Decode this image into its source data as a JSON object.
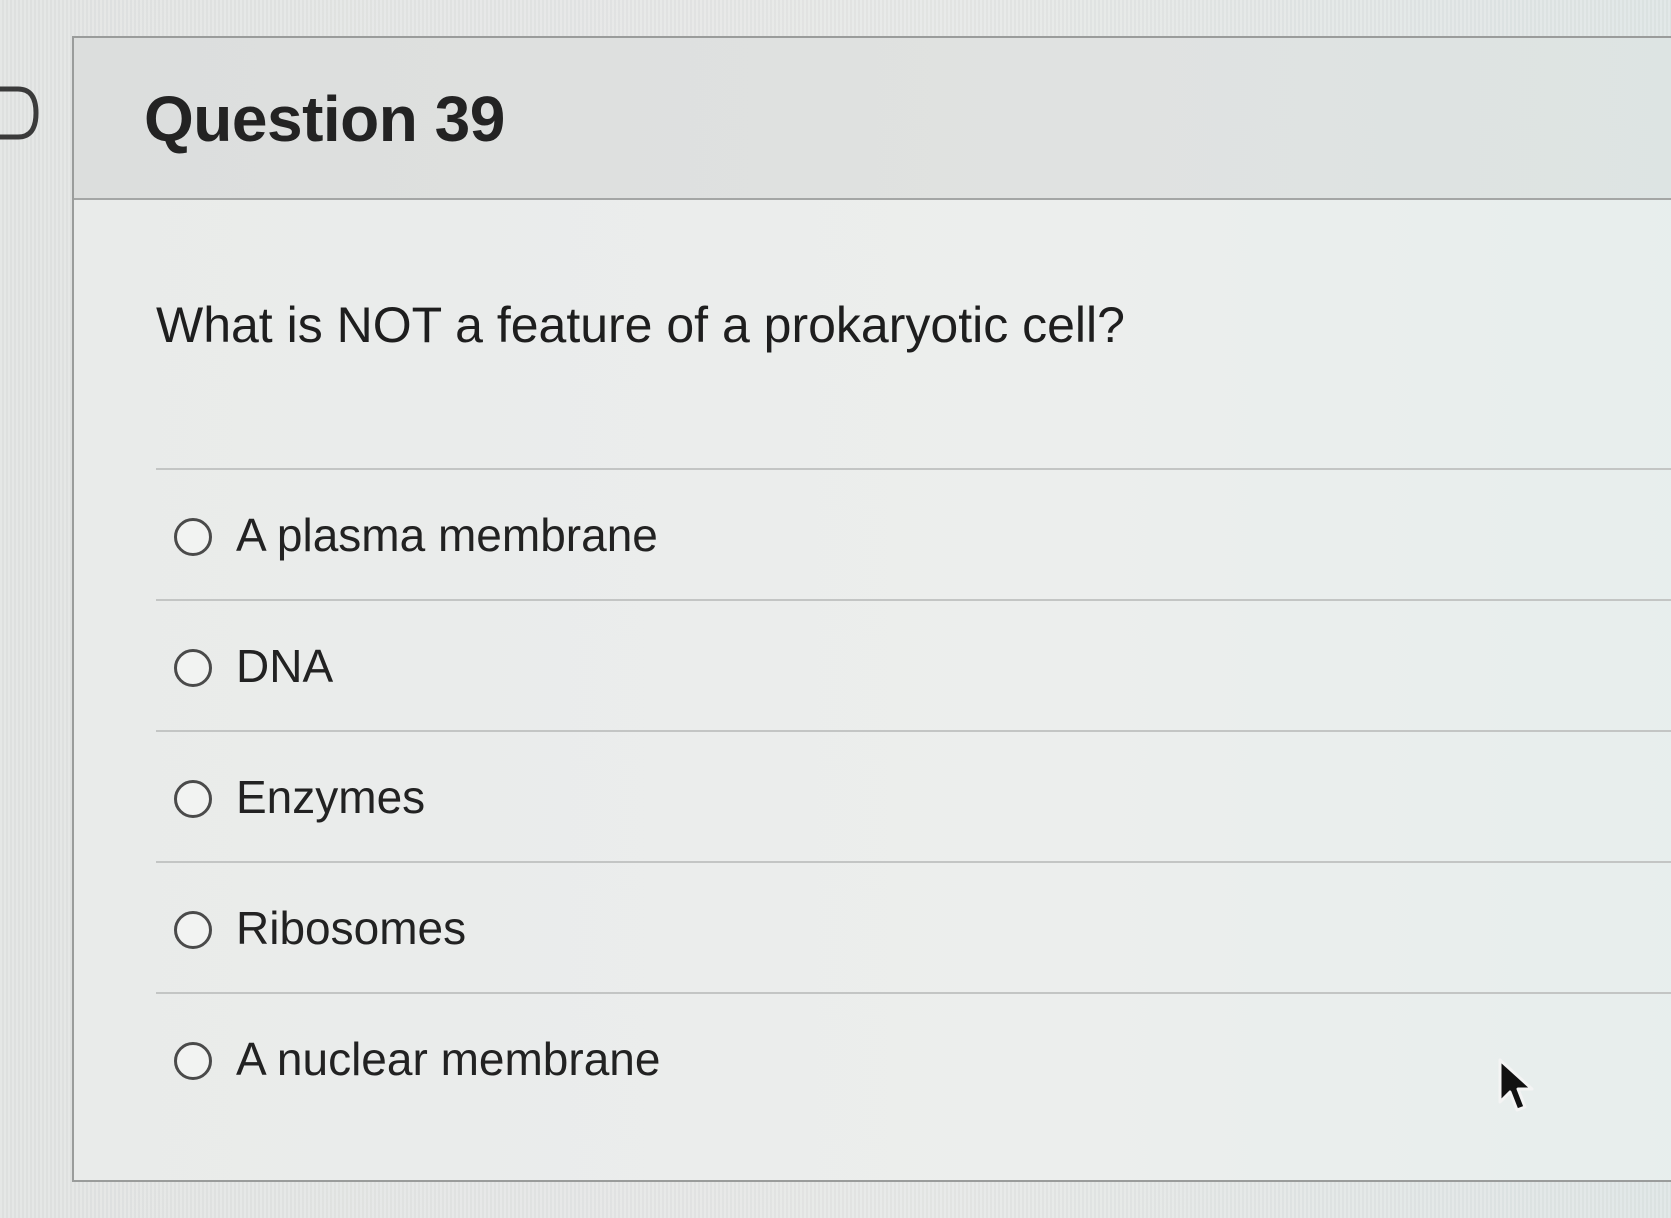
{
  "question": {
    "title": "Question 39",
    "text": "What is NOT a feature of a prokaryotic cell?",
    "answers": [
      {
        "label": "A plasma membrane",
        "selected": false
      },
      {
        "label": "DNA",
        "selected": false
      },
      {
        "label": "Enzymes",
        "selected": false
      },
      {
        "label": "Ribosomes",
        "selected": false
      },
      {
        "label": "A nuclear membrane",
        "selected": false
      }
    ]
  },
  "icons": {
    "flag": "flag-marker-icon",
    "radio": "radio-button-icon",
    "cursor": "mouse-pointer-icon"
  },
  "colors": {
    "background": "#e4e6e5",
    "header": "#dcdedd",
    "border": "#9a9c9b",
    "text": "#1f1f1f"
  }
}
